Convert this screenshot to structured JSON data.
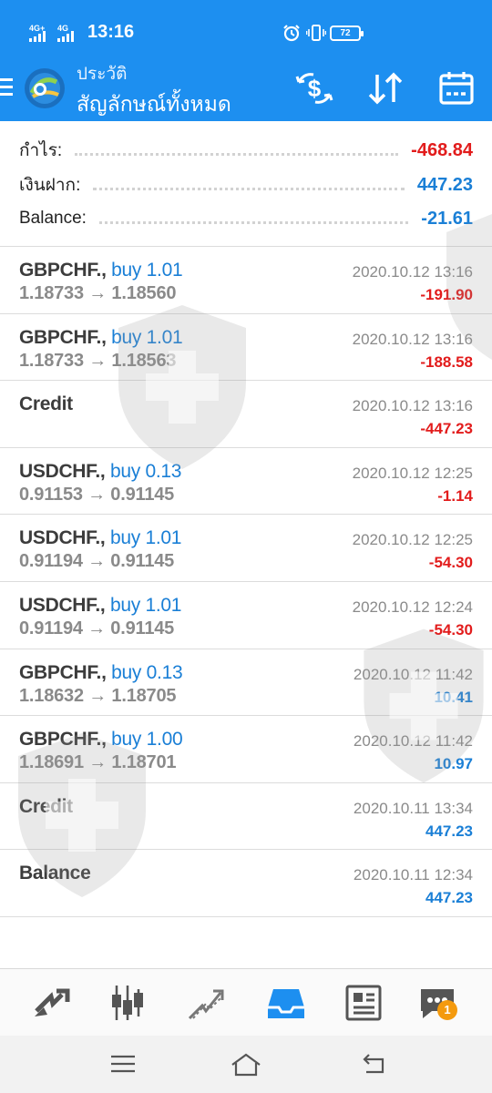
{
  "status_bar": {
    "network_1": "4G+",
    "network_2": "4G",
    "time": "13:16",
    "battery": "72"
  },
  "app_bar": {
    "subtitle": "ประวัติ",
    "title": "สัญลักษณ์ทั้งหมด",
    "icons": [
      "menu-icon",
      "metatrader-logo",
      "currency-swap-icon",
      "sort-icon",
      "calendar-icon"
    ]
  },
  "summary": [
    {
      "label": "กำไร:",
      "value": "-468.84",
      "color": "red"
    },
    {
      "label": "เงินฝาก:",
      "value": "447.23",
      "color": "blue"
    },
    {
      "label": "Balance:",
      "value": "-21.61",
      "color": "blue"
    }
  ],
  "deals": [
    {
      "symbol": "GBPCHF.,",
      "side": "buy 1.01",
      "prices": "1.18733 → 1.18560",
      "time": "2020.10.12 13:16",
      "profit": "-191.90",
      "color": "red"
    },
    {
      "symbol": "GBPCHF.,",
      "side": "buy 1.01",
      "prices": "1.18733 → 1.18563",
      "time": "2020.10.12 13:16",
      "profit": "-188.58",
      "color": "red"
    },
    {
      "symbol": "Credit",
      "side": "",
      "prices": "",
      "time": "2020.10.12 13:16",
      "profit": "-447.23",
      "color": "red"
    },
    {
      "symbol": "USDCHF.,",
      "side": "buy 0.13",
      "prices": "0.91153 → 0.91145",
      "time": "2020.10.12 12:25",
      "profit": "-1.14",
      "color": "red"
    },
    {
      "symbol": "USDCHF.,",
      "side": "buy 1.01",
      "prices": "0.91194 → 0.91145",
      "time": "2020.10.12 12:25",
      "profit": "-54.30",
      "color": "red"
    },
    {
      "symbol": "USDCHF.,",
      "side": "buy 1.01",
      "prices": "0.91194 → 0.91145",
      "time": "2020.10.12 12:24",
      "profit": "-54.30",
      "color": "red"
    },
    {
      "symbol": "GBPCHF.,",
      "side": "buy 0.13",
      "prices": "1.18632 → 1.18705",
      "time": "2020.10.12 11:42",
      "profit": "10.41",
      "color": "blue"
    },
    {
      "symbol": "GBPCHF.,",
      "side": "buy 1.00",
      "prices": "1.18691 → 1.18701",
      "time": "2020.10.12 11:42",
      "profit": "10.97",
      "color": "blue"
    },
    {
      "symbol": "Credit",
      "side": "",
      "prices": "",
      "time": "2020.10.11 13:34",
      "profit": "447.23",
      "color": "blue"
    },
    {
      "symbol": "Balance",
      "side": "",
      "prices": "",
      "time": "2020.10.11 12:34",
      "profit": "447.23",
      "color": "blue"
    }
  ],
  "bottom_nav": {
    "items": [
      "quotes-icon",
      "chart-icon",
      "trade-icon",
      "history-icon",
      "news-icon",
      "chat-icon"
    ],
    "active": "history-icon",
    "chat_badge": "1"
  },
  "colors": {
    "accent": "#1d8ff0",
    "loss": "#e21c1c",
    "profit": "#1a7fd6",
    "badge": "#f49a0e"
  }
}
